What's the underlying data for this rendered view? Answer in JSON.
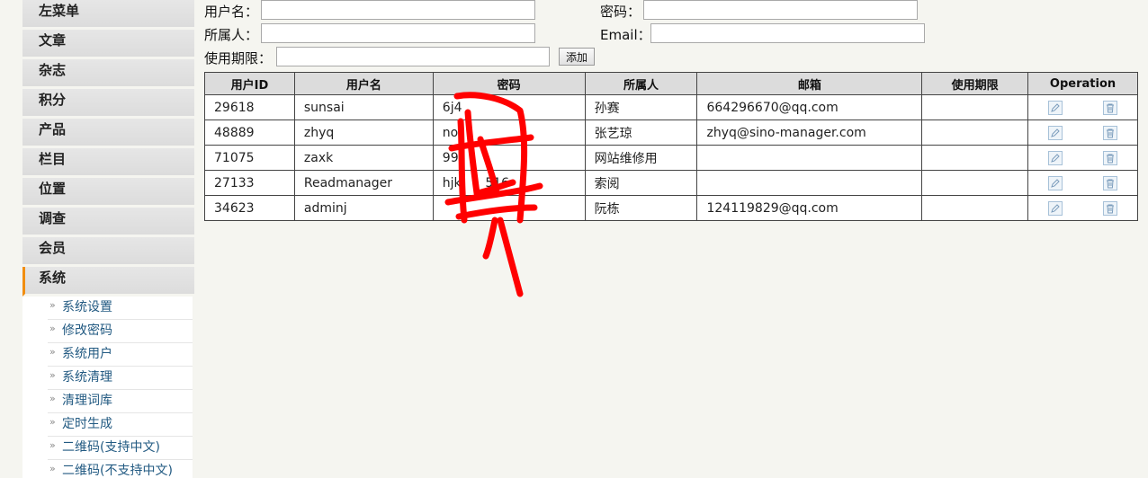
{
  "sidebar": {
    "items": [
      {
        "label": "左菜单"
      },
      {
        "label": "文章"
      },
      {
        "label": "杂志"
      },
      {
        "label": "积分"
      },
      {
        "label": "产品"
      },
      {
        "label": "栏目"
      },
      {
        "label": "位置"
      },
      {
        "label": "调查"
      },
      {
        "label": "会员"
      },
      {
        "label": "系统"
      }
    ],
    "submenu": [
      {
        "label": "系统设置"
      },
      {
        "label": "修改密码"
      },
      {
        "label": "系统用户"
      },
      {
        "label": "系统清理"
      },
      {
        "label": "清理词库"
      },
      {
        "label": "定时生成"
      },
      {
        "label": "二维码(支持中文)"
      },
      {
        "label": "二维码(不支持中文)"
      }
    ],
    "bullet": "»"
  },
  "form": {
    "username_label": "用户名：",
    "password_label": "密码：",
    "owner_label": "所属人：",
    "email_label": "Email：",
    "period_label": "使用期限：",
    "username_value": "",
    "password_value": "",
    "owner_value": "",
    "email_value": "",
    "period_value": "",
    "add_label": "添加"
  },
  "table": {
    "headers": [
      "用户ID",
      "用户名",
      "密码",
      "所属人",
      "邮箱",
      "使用期限",
      "Operation"
    ],
    "rows": [
      {
        "id": "29618",
        "username": "sunsai",
        "password": "6j4",
        "owner": "孙赛",
        "email": "664296670@qq.com",
        "period": ""
      },
      {
        "id": "48889",
        "username": "zhyq",
        "password": "no",
        "owner": "张艺琼",
        "email": "zhyq@sino-manager.com",
        "period": ""
      },
      {
        "id": "71075",
        "username": "zaxk",
        "password": "99",
        "owner": "网站维修用",
        "email": "",
        "period": ""
      },
      {
        "id": "27133",
        "username": "Readmanager",
        "password": "hjk      516",
        "owner": "索阅",
        "email": "",
        "period": ""
      },
      {
        "id": "34623",
        "username": "adminj",
        "password": "",
        "owner": "阮栋",
        "email": "124119829@qq.com",
        "period": ""
      }
    ]
  },
  "colors": {
    "active_marker": "#f18e10",
    "link": "#225a82",
    "scribble": "#ff0000"
  },
  "icons": {
    "edit": "edit-icon",
    "delete": "trash-icon"
  }
}
